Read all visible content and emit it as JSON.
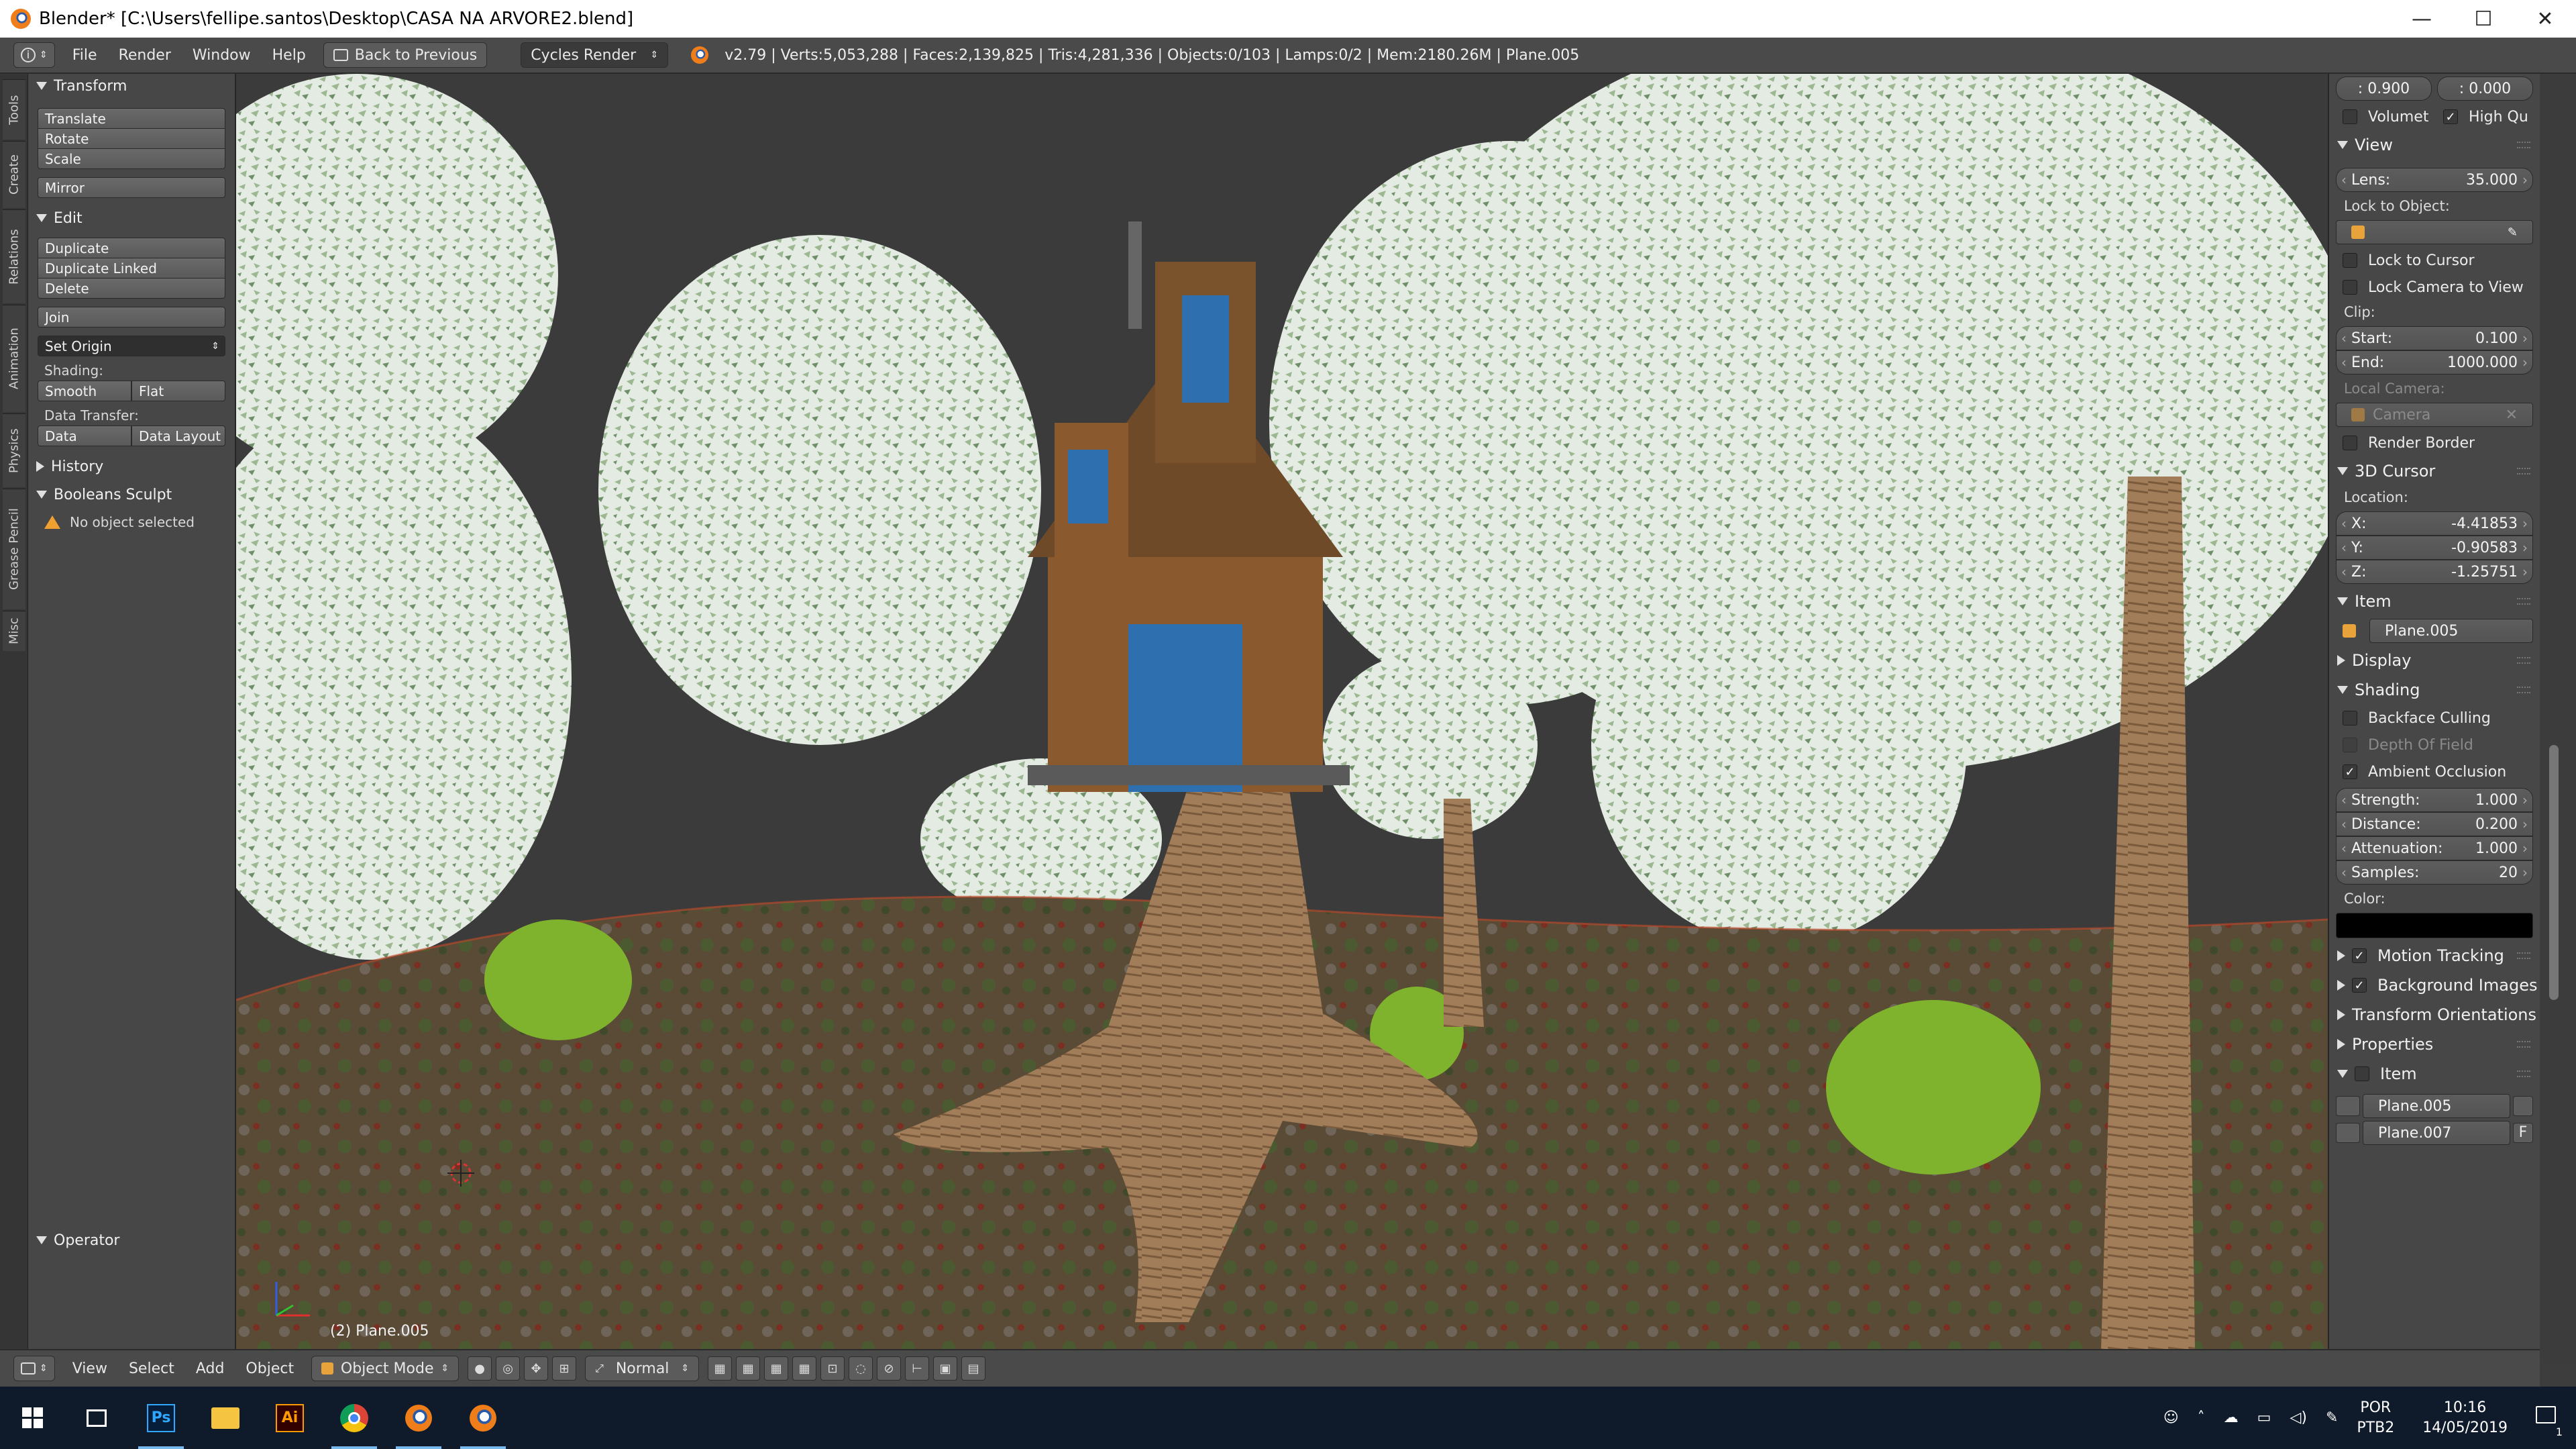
{
  "window": {
    "title": "Blender* [C:\\Users\\fellipe.santos\\Desktop\\CASA NA ARVORE2.blend]",
    "minimize": "—",
    "maximize": "☐",
    "close": "✕"
  },
  "header": {
    "menus": [
      "File",
      "Render",
      "Window",
      "Help"
    ],
    "back_button": "Back to Previous",
    "render_engine": "Cycles Render",
    "stats": "v2.79 | Verts:5,053,288 | Faces:2,139,825 | Tris:4,281,336 | Objects:0/103 | Lamps:0/2 | Mem:2180.26M | Plane.005"
  },
  "toolshelf": {
    "tabs": [
      "Tools",
      "Create",
      "Relations",
      "Animation",
      "Physics",
      "Grease Pencil",
      "Misc"
    ],
    "transform_title": "Transform",
    "transform_buttons": [
      "Translate",
      "Rotate",
      "Scale"
    ],
    "mirror": "Mirror",
    "edit_title": "Edit",
    "edit_buttons": [
      "Duplicate",
      "Duplicate Linked",
      "Delete"
    ],
    "join": "Join",
    "set_origin": "Set Origin",
    "shading_label": "Shading:",
    "smooth": "Smooth",
    "flat": "Flat",
    "data_transfer_label": "Data Transfer:",
    "data": "Data",
    "data_layout": "Data Layout",
    "history_title": "History",
    "booleans_title": "Booleans Sculpt",
    "no_object": "No object selected",
    "operator_title": "Operator"
  },
  "viewport": {
    "object_label": "(2) Plane.005"
  },
  "props": {
    "top_left": ": 0.900",
    "top_right": ": 0.000",
    "volumet": "Volumet",
    "high_qu": "High Qu",
    "view_title": "View",
    "lens_label": "Lens:",
    "lens_value": "35.000",
    "lock_to_object": "Lock to Object:",
    "lock_to_cursor": "Lock to Cursor",
    "lock_camera": "Lock Camera to View",
    "clip_label": "Clip:",
    "start_label": "Start:",
    "start_value": "0.100",
    "end_label": "End:",
    "end_value": "1000.000",
    "local_camera": "Local Camera:",
    "camera": "Camera",
    "render_border": "Render Border",
    "cursor_title": "3D Cursor",
    "location_label": "Location:",
    "x_label": "X:",
    "x_value": "-4.41853",
    "y_label": "Y:",
    "y_value": "-0.90583",
    "z_label": "Z:",
    "z_value": "-1.25751",
    "item_title": "Item",
    "item_name": "Plane.005",
    "display_title": "Display",
    "shading_title": "Shading",
    "backface": "Backface Culling",
    "dof": "Depth Of Field",
    "ao": "Ambient Occlusion",
    "strength_label": "Strength:",
    "strength_value": "1.000",
    "distance_label": "Distance:",
    "distance_value": "0.200",
    "attenuation_label": "Attenuation:",
    "attenuation_value": "1.000",
    "samples_label": "Samples:",
    "samples_value": "20",
    "color_label": "Color:",
    "motion_tracking": "Motion Tracking",
    "background_images": "Background Images",
    "transform_orientations": "Transform Orientations",
    "properties": "Properties",
    "item2_title": "Item",
    "plane005": "Plane.005",
    "plane007": "Plane.007",
    "f_label": "F"
  },
  "footer": {
    "menus": [
      "View",
      "Select",
      "Add",
      "Object"
    ],
    "mode": "Object Mode",
    "pivot": "Normal"
  },
  "taskbar": {
    "lang": "POR",
    "layout": "PTB2",
    "time": "10:16",
    "date": "14/05/2019",
    "notif_count": "1"
  },
  "colors": {
    "bg": "#3d3d3d",
    "panel": "#474747",
    "header": "#4a4a4a",
    "accent_orange": "#e77d1c",
    "taskbar": "#0f1a2a"
  }
}
